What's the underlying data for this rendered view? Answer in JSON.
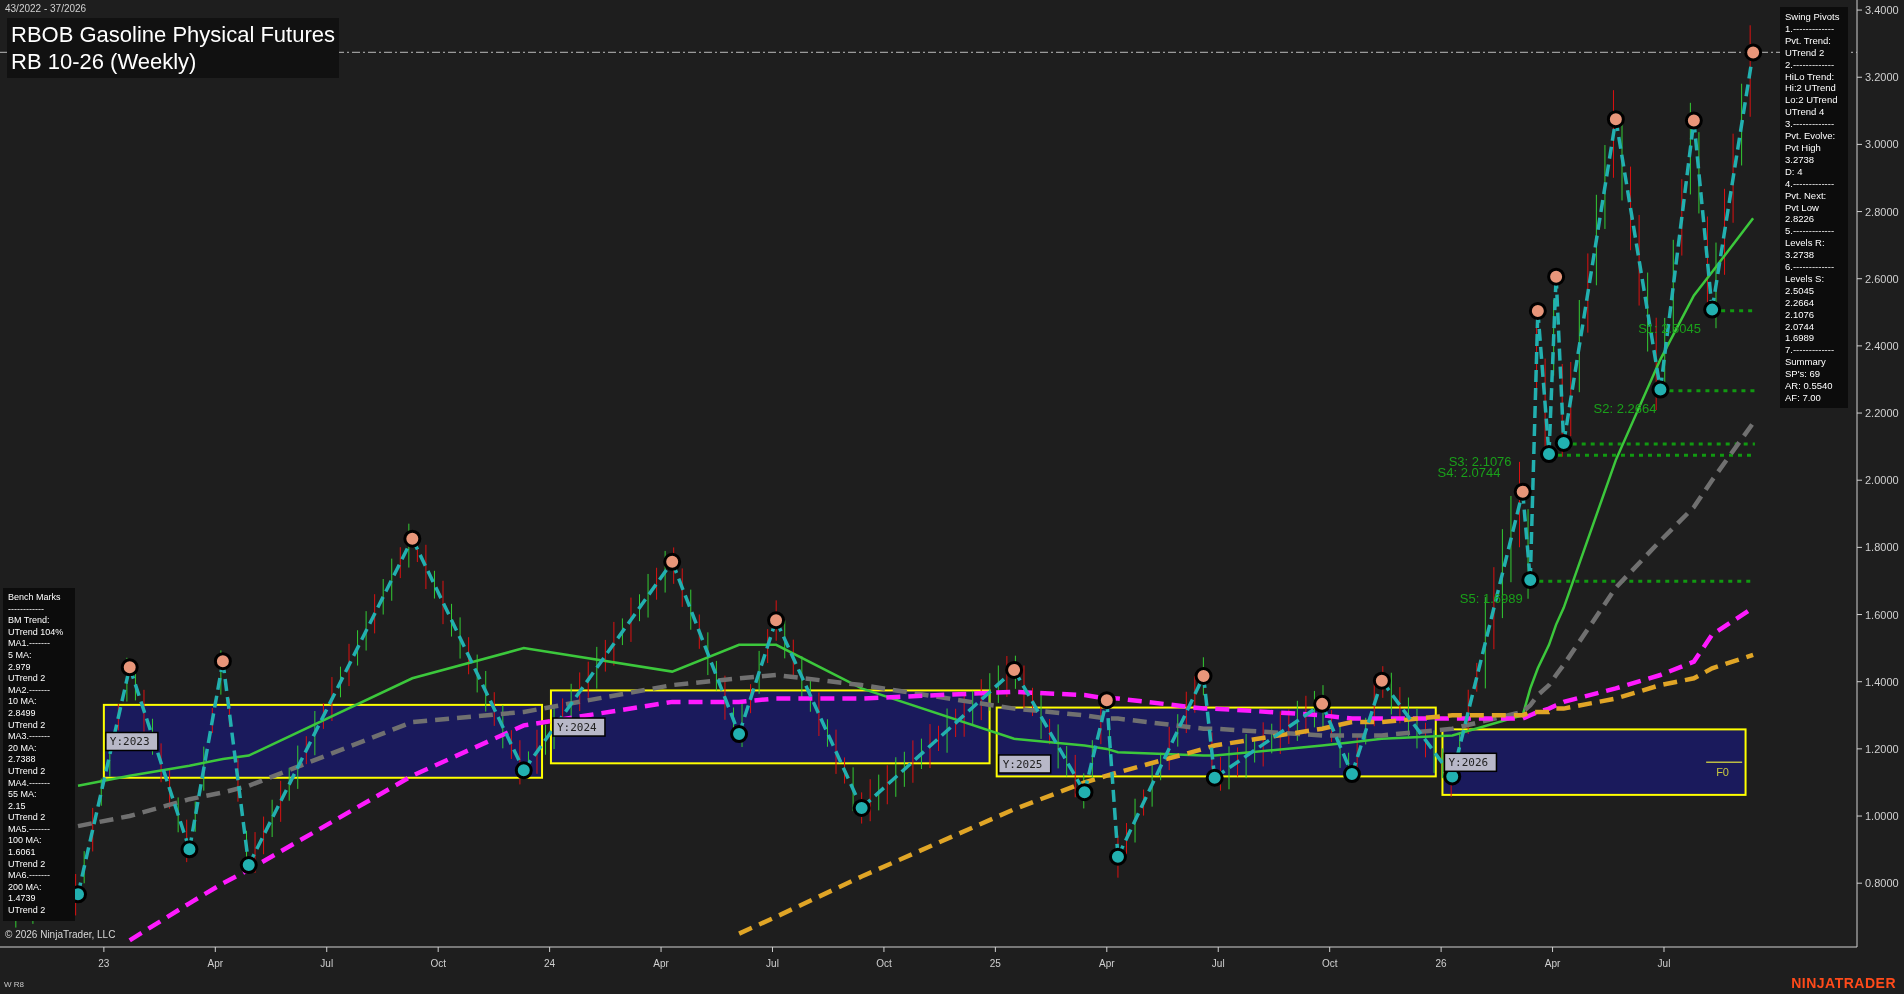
{
  "header": {
    "date_range": "43/2022 - 37/2026",
    "title": "RBOB Gasoline Physical Futures",
    "subtitle": "RB 10-26 (Weekly)"
  },
  "chart": {
    "chart_data": {
      "type": "line",
      "xlim": [
        22.767,
        26.933
      ],
      "ylim": [
        0.61,
        3.43
      ],
      "xticks": [
        23,
        {
          "value": 23.25,
          "label": "Apr"
        },
        {
          "value": 23.5,
          "label": "Jul"
        },
        {
          "value": 23.75,
          "label": "Oct"
        },
        24,
        {
          "value": 24.25,
          "label": "Apr"
        },
        {
          "value": 24.5,
          "label": "Jul"
        },
        {
          "value": 24.75,
          "label": "Oct"
        },
        25,
        {
          "value": 25.25,
          "label": "Apr"
        },
        {
          "value": 25.5,
          "label": "Jul"
        },
        {
          "value": 25.75,
          "label": "Oct"
        },
        26,
        {
          "value": 26.25,
          "label": "Apr"
        },
        {
          "value": 26.5,
          "label": "Jul"
        }
      ],
      "yticks": [
        {
          "value": 0.8,
          "label": "0.8000"
        },
        {
          "value": 1.0,
          "label": "1.0000"
        },
        {
          "value": 1.2,
          "label": "1.2000"
        },
        {
          "value": 1.4,
          "label": "1.4000"
        },
        {
          "value": 1.6,
          "label": "1.6000"
        },
        {
          "value": 1.8,
          "label": "1.8000"
        },
        {
          "value": 2.0,
          "label": "2.0000"
        },
        {
          "value": 2.2,
          "label": "2.2000"
        },
        {
          "value": 2.4,
          "label": "2.4000"
        },
        {
          "value": 2.6,
          "label": "2.6000"
        },
        {
          "value": 2.8,
          "label": "2.8000"
        },
        {
          "value": 3.0,
          "label": "3.0000"
        },
        {
          "value": 3.2,
          "label": "3.2000"
        },
        {
          "value": 3.4,
          "label": "3.4000"
        }
      ],
      "x": [
        22.942,
        23.058,
        23.192,
        23.267,
        23.325,
        23.692,
        23.942,
        24.275,
        24.425,
        24.508,
        24.7,
        25.042,
        25.2,
        25.25,
        25.275,
        25.467,
        25.492,
        25.733,
        25.8,
        25.867,
        26.025,
        26.183,
        26.2,
        26.217,
        26.242,
        26.258,
        26.275,
        26.392,
        26.492,
        26.567,
        26.608,
        26.7
      ],
      "series": [
        {
          "color": "#22b0b0",
          "line_style": "dashed",
          "marker": "circle",
          "values": [
            0.767,
            1.443,
            0.901,
            1.461,
            0.854,
            1.826,
            1.136,
            1.757,
            1.244,
            1.583,
            1.024,
            1.435,
            1.071,
            1.345,
            0.879,
            1.417,
            1.114,
            1.334,
            1.125,
            1.403,
            1.118,
            1.966,
            1.703,
            2.504,
            2.078,
            2.606,
            2.111,
            3.075,
            2.27,
            3.071,
            2.508,
            3.274
          ]
        },
        {
          "color": "#3cc83c",
          "values": [
            1.09,
            1.12,
            1.15,
            1.17,
            1.18,
            1.41,
            1.5,
            1.43,
            1.51,
            1.51,
            1.38,
            1.23,
            1.21,
            1.2,
            1.19,
            1.18,
            1.18,
            1.21,
            1.22,
            1.23,
            1.24,
            1.3,
            1.38,
            1.44,
            1.51,
            1.57,
            1.62,
            2.06,
            2.36,
            2.55,
            2.62,
            2.78
          ]
        },
        {
          "color": "#707070",
          "line_style": "dashed",
          "values": [
            0.97,
            1.0,
            1.05,
            1.07,
            1.09,
            1.28,
            1.31,
            1.39,
            1.41,
            1.42,
            1.39,
            1.32,
            1.3,
            1.29,
            1.29,
            1.26,
            1.26,
            1.24,
            1.24,
            1.24,
            1.26,
            1.31,
            1.33,
            1.36,
            1.39,
            1.42,
            1.45,
            1.68,
            1.82,
            1.92,
            2.0,
            2.17
          ]
        },
        {
          "color": "#ff1aff",
          "line_style": "dashed",
          "values": [
            null,
            0.63,
            0.74,
            0.8,
            0.84,
            1.12,
            1.27,
            1.34,
            1.34,
            1.35,
            1.35,
            1.37,
            1.36,
            1.35,
            1.35,
            1.32,
            1.32,
            1.3,
            1.29,
            1.29,
            1.29,
            1.29,
            1.3,
            1.31,
            1.32,
            1.33,
            1.34,
            1.38,
            1.42,
            1.46,
            1.54,
            1.62
          ]
        },
        {
          "color": "#e0a526",
          "line_style": "dashed",
          "values": [
            null,
            null,
            null,
            null,
            null,
            null,
            null,
            null,
            0.65,
            0.7,
            0.82,
            1.02,
            1.1,
            1.12,
            1.13,
            1.2,
            1.21,
            1.26,
            1.28,
            1.28,
            1.3,
            1.3,
            1.31,
            1.31,
            1.31,
            1.32,
            1.32,
            1.35,
            1.39,
            1.41,
            1.44,
            1.48
          ]
        }
      ],
      "ref_lines": [
        {
          "axis": "y",
          "value": 3.2738
        },
        {
          "axis": "y",
          "value": 2.5045,
          "label": "S1: 2.5045"
        },
        {
          "axis": "y",
          "value": 2.2664,
          "label": "S2: 2.2664"
        },
        {
          "axis": "y",
          "value": 2.1076,
          "label": "S3: 2.1076"
        },
        {
          "axis": "y",
          "value": 2.0744,
          "label": "S4: 2.0744"
        },
        {
          "axis": "y",
          "value": 1.6989,
          "label": "S5: 1.6989"
        }
      ],
      "annotations": [
        "Y:2023",
        "Y:2024",
        "Y:2025",
        "Y:2026",
        "F0"
      ]
    }
  },
  "swing_pivots_panel": {
    "lines": [
      "Swing Pivots",
      "1.-------------",
      "Pvt. Trend:",
      "UTrend 2",
      "2.-------------",
      "HiLo Trend:",
      "Hi:2 UTrend",
      "Lo:2 UTrend",
      "UTrend 4",
      "3.-------------",
      "Pvt. Evolve:",
      "Pvt High",
      "3.2738",
      "D: 4",
      "4.-------------",
      "Pvt. Next:",
      "Pvt Low",
      "2.8226",
      "5.-------------",
      "Levels R:",
      "3.2738",
      "6.-------------",
      "Levels S:",
      "2.5045",
      "2.2664",
      "2.1076",
      "2.0744",
      "1.6989",
      "7.-------------",
      "Summary",
      "SP's: 69",
      "AR: 0.5540",
      "AF: 7.00"
    ]
  },
  "bench_marks_panel": {
    "lines": [
      "Bench Marks",
      "------------",
      "BM Trend:",
      "UTrend 104%",
      "MA1.-------",
      "5 MA:",
      "2.979",
      "UTrend 2",
      "MA2.-------",
      "10 MA:",
      "2.8499",
      "UTrend 2",
      "MA3.-------",
      "20 MA:",
      "2.7388",
      "UTrend 2",
      "MA4.-------",
      "55 MA:",
      "2.15",
      "UTrend 2",
      "MA5.-------",
      "100 MA:",
      "1.6061",
      "UTrend 2",
      "MA6.-------",
      "200 MA:",
      "1.4739",
      "UTrend 2"
    ]
  },
  "footer": {
    "copyright": "© 2026 NinjaTrader, LLC",
    "account": "W R8",
    "logo": "NINJATRADER"
  }
}
